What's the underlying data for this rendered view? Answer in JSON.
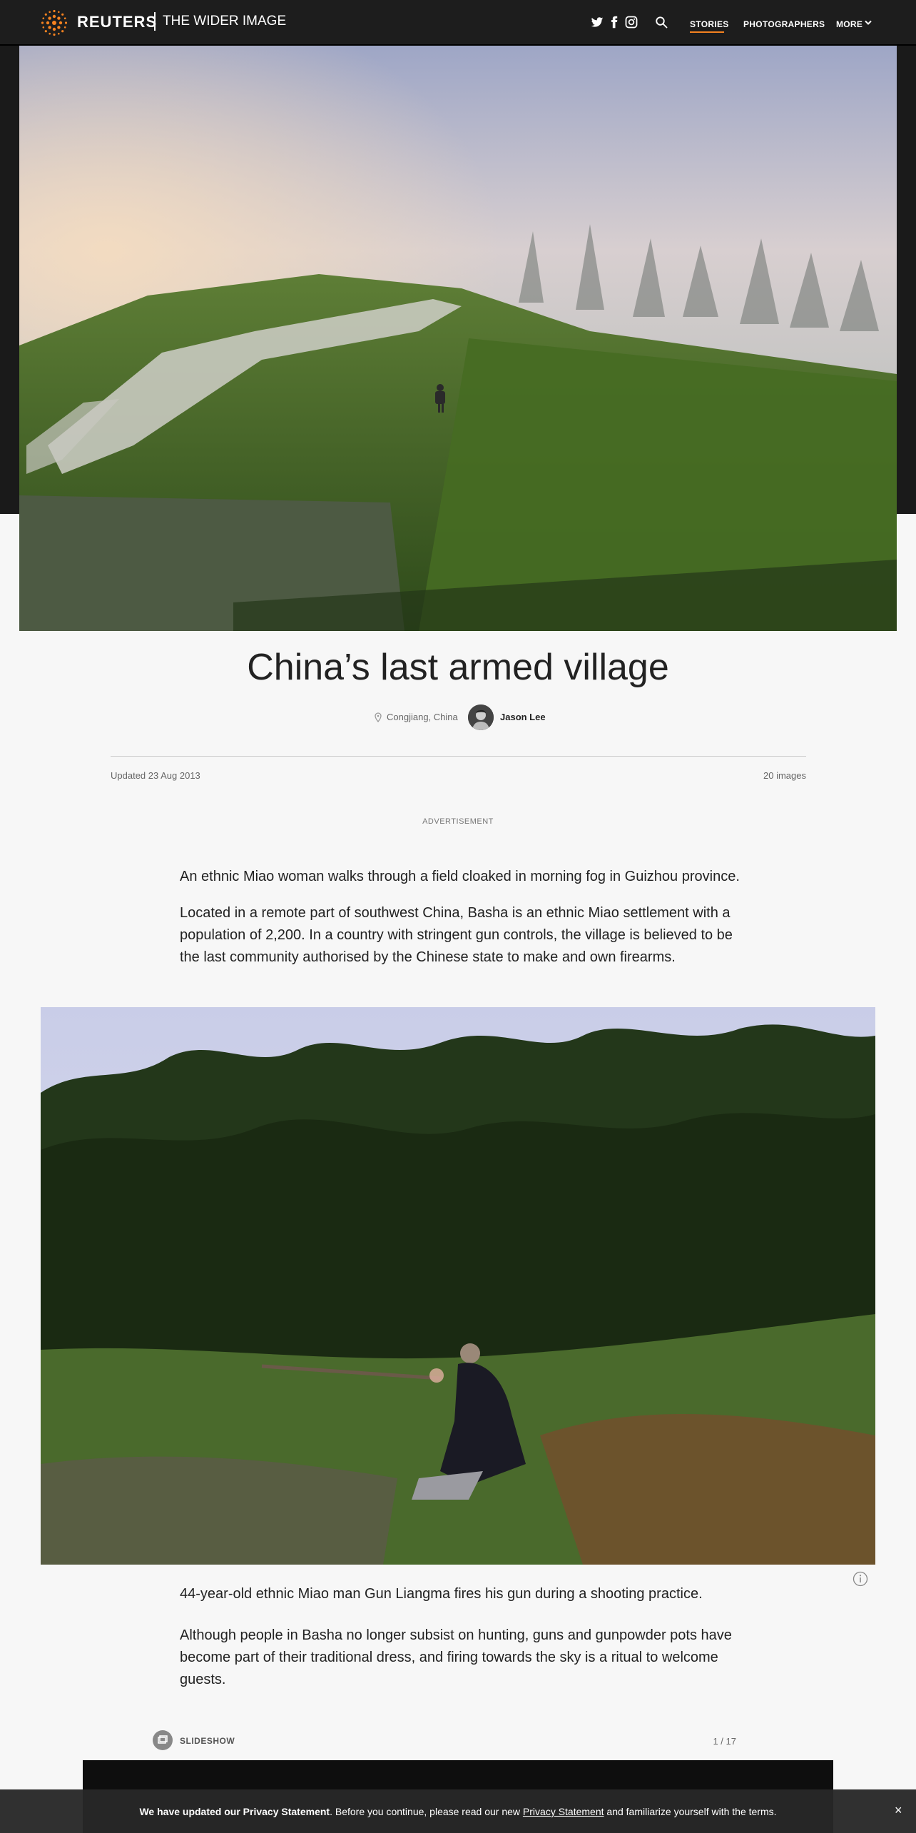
{
  "header": {
    "brand": "REUTERS",
    "section": "THE WIDER IMAGE",
    "social_icons": [
      "twitter-icon",
      "facebook-icon",
      "instagram-icon"
    ],
    "nav": [
      "STORIES",
      "PHOTOGRAPHERS",
      "MORE"
    ],
    "active_nav": "STORIES",
    "accent_color": "#f58220"
  },
  "story": {
    "title": "China’s last armed village",
    "location": "Congjiang, China",
    "author": "Jason Lee",
    "updated": "Updated 23 Aug 2013",
    "images_count": "20 images",
    "advertisement_label": "ADVERTISEMENT"
  },
  "captions": {
    "first_caption": "An ethnic Miao woman walks through a field cloaked in morning fog in Guizhou province.",
    "first_body": "Located in a remote part of southwest China, Basha is an ethnic Miao settlement with a population of 2,200. In a country with stringent gun controls, the village is believed to be the last community authorised by the Chinese state to make and own firearms.",
    "second_caption": "44-year-old ethnic Miao man Gun Liangma fires his gun during a shooting practice.",
    "second_body": "Although people in Basha no longer subsist on hunting, guns and gunpowder pots have become part of their traditional dress, and firing towards the sky is a ritual to welcome guests."
  },
  "slideshow": {
    "label": "SLIDESHOW",
    "counter": "1 / 17"
  },
  "privacy_banner": {
    "bold": "We have updated our Privacy Statement",
    "text_before_link": ". Before you continue, please read our new ",
    "link": "Privacy Statement",
    "text_after_link": " and familiarize yourself with the terms.",
    "close": "×"
  }
}
